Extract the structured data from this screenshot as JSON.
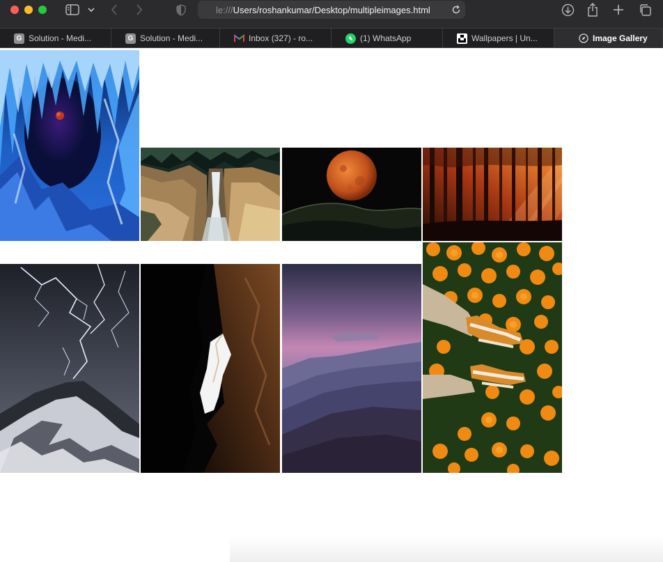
{
  "browser": {
    "address_prefix": "le:///",
    "address_main": "Users/roshankumar/Desktop/multipleimages.html",
    "tabs": [
      {
        "label": "Solution - Medi...",
        "icon": "g-icon"
      },
      {
        "label": "Solution - Medi...",
        "icon": "g-icon"
      },
      {
        "label": "Inbox (327) - ro...",
        "icon": "gmail-icon"
      },
      {
        "label": "(1) WhatsApp",
        "icon": "whatsapp-icon"
      },
      {
        "label": "Wallpapers | Un...",
        "icon": "unsplash-icon"
      },
      {
        "label": "Image Gallery",
        "icon": "compass-icon",
        "active": true
      }
    ]
  },
  "gallery": {
    "images": [
      {
        "subject": "ice-cave-blood-moon"
      },
      {
        "subject": "canyon-waterfall"
      },
      {
        "subject": "orange-moon-hills"
      },
      {
        "subject": "autumn-forest-sunrays"
      },
      {
        "subject": "lightning-mountain"
      },
      {
        "subject": "dark-cave-opening"
      },
      {
        "subject": "purple-mountain-haze"
      },
      {
        "subject": "marigold-sneakers"
      }
    ]
  },
  "colors": {
    "toolbar_bg": "#2b2b2d",
    "tabbar_bg": "#1f1f21",
    "active_tab_bg": "#2e2e31"
  }
}
